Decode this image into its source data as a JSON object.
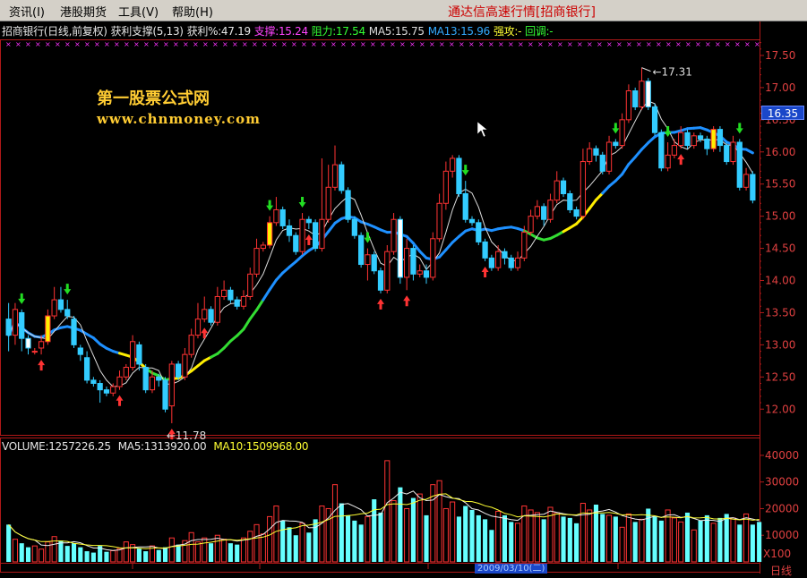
{
  "menu": [
    "资讯(I)",
    "港股期货",
    "工具(V)",
    "帮助(H)"
  ],
  "app_title": "通达信高速行情[招商银行]",
  "info": {
    "title": "招商银行(日线,前复权)",
    "indicator": "获利支撑(5,13)",
    "profit": "获利%:47.19",
    "support": "支撑:15.24",
    "resistance": "阻力:17.54",
    "ma5": "MA5:15.75",
    "ma13": "MA13:15.96",
    "strong": "强攻:-",
    "pullback": "回调:-"
  },
  "watermark": {
    "line1": "第一股票公式网",
    "line2": "www.chnmoney.com"
  },
  "volume_info": {
    "volume": "VOLUME:1257226.25",
    "ma5": "MA5:1313920.00",
    "ma10": "MA10:1509968.00"
  },
  "current_price": "16.35",
  "vol_unit": "X100",
  "date_label": "2009/03/10(二)",
  "period": "日线",
  "colors": {
    "up": "#ff3333",
    "down": "#33ccff",
    "ma_line": "#1e90ff",
    "support_lime": "#33dd33",
    "yellow": "#ffee00",
    "axis": "#b01818"
  },
  "chart_data": {
    "type": "candlestick",
    "price_axis": {
      "ticks": [
        "12.00",
        "12.50",
        "13.00",
        "13.50",
        "14.00",
        "14.50",
        "15.00",
        "15.50",
        "16.00",
        "16.50",
        "17.00",
        "17.50"
      ],
      "range": [
        11.6,
        17.75
      ]
    },
    "annotations": [
      {
        "label": "17.31"
      },
      {
        "label": "11.78"
      }
    ],
    "candles": [
      [
        13.4,
        13.15,
        13.65,
        12.9
      ],
      [
        13.15,
        13.55,
        13.65,
        13.0
      ],
      [
        13.5,
        13.1,
        13.55,
        12.9
      ],
      [
        13.1,
        12.95,
        13.15,
        12.85
      ],
      [
        12.9,
        12.9,
        12.95,
        12.85
      ],
      [
        12.95,
        13.05,
        13.15,
        12.85
      ],
      [
        13.05,
        13.45,
        13.55,
        13.0
      ],
      [
        13.45,
        13.7,
        13.9,
        13.4
      ],
      [
        13.7,
        13.55,
        13.9,
        13.5
      ],
      [
        13.55,
        13.45,
        13.7,
        13.4
      ],
      [
        13.4,
        13.0,
        13.45,
        12.95
      ],
      [
        12.95,
        12.85,
        13.0,
        12.75
      ],
      [
        12.8,
        12.45,
        12.9,
        12.4
      ],
      [
        12.45,
        12.4,
        12.5,
        12.35
      ],
      [
        12.4,
        12.3,
        12.45,
        12.1
      ],
      [
        12.3,
        12.25,
        12.35,
        12.2
      ],
      [
        12.25,
        12.35,
        12.4,
        12.2
      ],
      [
        12.35,
        12.5,
        12.6,
        12.3
      ],
      [
        12.5,
        12.65,
        12.7,
        12.45
      ],
      [
        12.65,
        13.05,
        13.15,
        12.6
      ],
      [
        13.0,
        12.7,
        13.05,
        12.6
      ],
      [
        12.65,
        12.3,
        12.7,
        12.25
      ],
      [
        12.3,
        12.5,
        12.6,
        12.25
      ],
      [
        12.5,
        12.45,
        12.55,
        12.35
      ],
      [
        12.45,
        12.0,
        12.5,
        11.95
      ],
      [
        12.05,
        12.7,
        12.75,
        11.78
      ],
      [
        12.7,
        12.5,
        12.75,
        12.45
      ],
      [
        12.5,
        12.85,
        12.95,
        12.45
      ],
      [
        12.85,
        13.15,
        13.25,
        12.8
      ],
      [
        13.15,
        13.4,
        13.65,
        13.1
      ],
      [
        13.4,
        13.55,
        13.75,
        13.35
      ],
      [
        13.55,
        13.35,
        13.6,
        13.3
      ],
      [
        13.35,
        13.75,
        13.9,
        13.3
      ],
      [
        13.75,
        13.85,
        14.0,
        13.7
      ],
      [
        13.85,
        13.7,
        13.9,
        13.65
      ],
      [
        13.7,
        13.6,
        13.75,
        13.55
      ],
      [
        13.6,
        13.75,
        13.85,
        13.55
      ],
      [
        13.75,
        14.1,
        14.2,
        13.7
      ],
      [
        14.1,
        14.5,
        14.65,
        14.05
      ],
      [
        14.5,
        14.55,
        14.6,
        14.45
      ],
      [
        14.55,
        14.9,
        15.0,
        14.5
      ],
      [
        14.9,
        15.1,
        15.3,
        14.85
      ],
      [
        15.1,
        14.85,
        15.15,
        14.8
      ],
      [
        14.85,
        14.7,
        14.95,
        14.6
      ],
      [
        14.7,
        14.45,
        14.75,
        14.4
      ],
      [
        14.45,
        14.95,
        15.05,
        14.4
      ],
      [
        14.95,
        14.9,
        15.0,
        14.8
      ],
      [
        14.9,
        14.5,
        14.95,
        14.45
      ],
      [
        14.5,
        14.95,
        15.9,
        14.45
      ],
      [
        14.95,
        15.45,
        15.8,
        14.9
      ],
      [
        15.45,
        15.8,
        16.1,
        15.4
      ],
      [
        15.8,
        15.4,
        15.85,
        15.35
      ],
      [
        15.4,
        14.95,
        15.45,
        14.9
      ],
      [
        14.95,
        14.7,
        15.0,
        14.65
      ],
      [
        14.7,
        14.25,
        14.75,
        14.2
      ],
      [
        14.25,
        14.4,
        14.5,
        14.0
      ],
      [
        14.4,
        14.15,
        14.45,
        14.1
      ],
      [
        14.15,
        13.85,
        14.2,
        13.8
      ],
      [
        13.85,
        14.45,
        14.55,
        13.8
      ],
      [
        14.45,
        14.95,
        15.05,
        14.4
      ],
      [
        14.95,
        14.05,
        15.0,
        13.95
      ],
      [
        14.05,
        14.5,
        14.65,
        13.85
      ],
      [
        14.5,
        14.1,
        14.55,
        14.0
      ],
      [
        14.1,
        14.15,
        14.25,
        14.05
      ],
      [
        14.15,
        14.05,
        14.25,
        13.95
      ],
      [
        14.05,
        14.65,
        14.75,
        14.0
      ],
      [
        14.65,
        15.2,
        15.35,
        14.6
      ],
      [
        15.2,
        15.7,
        15.85,
        15.1
      ],
      [
        15.7,
        15.9,
        15.95,
        15.6
      ],
      [
        15.9,
        15.35,
        15.95,
        15.3
      ],
      [
        15.35,
        14.95,
        15.55,
        14.9
      ],
      [
        14.95,
        14.9,
        15.0,
        14.85
      ],
      [
        14.9,
        14.6,
        14.95,
        14.55
      ],
      [
        14.6,
        14.35,
        14.65,
        14.3
      ],
      [
        14.35,
        14.2,
        14.4,
        14.15
      ],
      [
        14.2,
        14.45,
        14.55,
        14.15
      ],
      [
        14.45,
        14.35,
        14.5,
        14.25
      ],
      [
        14.35,
        14.2,
        14.4,
        14.15
      ],
      [
        14.2,
        14.35,
        14.45,
        14.15
      ],
      [
        14.35,
        14.75,
        14.85,
        14.3
      ],
      [
        14.75,
        15.0,
        15.1,
        14.7
      ],
      [
        15.0,
        15.15,
        15.25,
        14.95
      ],
      [
        15.15,
        14.95,
        15.2,
        14.85
      ],
      [
        14.95,
        15.25,
        15.35,
        14.9
      ],
      [
        15.25,
        15.55,
        15.7,
        15.2
      ],
      [
        15.55,
        15.35,
        15.6,
        15.3
      ],
      [
        15.35,
        15.1,
        15.4,
        15.05
      ],
      [
        15.1,
        15.0,
        15.15,
        14.95
      ],
      [
        15.0,
        15.85,
        16.05,
        14.95
      ],
      [
        15.85,
        16.05,
        16.15,
        15.8
      ],
      [
        16.05,
        15.95,
        16.1,
        15.85
      ],
      [
        15.95,
        15.7,
        16.0,
        15.65
      ],
      [
        15.7,
        16.15,
        16.25,
        15.65
      ],
      [
        16.15,
        16.1,
        16.2,
        16.05
      ],
      [
        16.1,
        16.5,
        16.6,
        16.05
      ],
      [
        16.5,
        16.95,
        17.05,
        16.45
      ],
      [
        16.95,
        16.7,
        17.0,
        16.65
      ],
      [
        16.7,
        17.1,
        17.31,
        16.65
      ],
      [
        17.1,
        16.7,
        17.15,
        16.65
      ],
      [
        16.7,
        16.3,
        16.75,
        16.25
      ],
      [
        16.3,
        15.75,
        16.35,
        15.7
      ],
      [
        15.75,
        15.95,
        16.15,
        15.7
      ],
      [
        15.95,
        16.1,
        16.2,
        15.9
      ],
      [
        16.1,
        16.3,
        16.4,
        16.05
      ],
      [
        16.3,
        16.1,
        16.35,
        16.05
      ],
      [
        16.1,
        16.25,
        16.3,
        16.05
      ],
      [
        16.25,
        16.2,
        16.3,
        16.15
      ],
      [
        16.2,
        16.05,
        16.25,
        15.95
      ],
      [
        16.05,
        16.35,
        16.4,
        16.0
      ],
      [
        16.35,
        16.1,
        16.4,
        16.0
      ],
      [
        16.1,
        15.85,
        16.15,
        15.8
      ],
      [
        15.85,
        16.15,
        16.25,
        15.8
      ],
      [
        16.15,
        15.45,
        16.2,
        15.4
      ],
      [
        15.45,
        15.65,
        15.75,
        15.4
      ],
      [
        15.65,
        15.25,
        15.7,
        15.2
      ]
    ],
    "volume_axis": {
      "ticks": [
        "10000",
        "20000",
        "30000",
        "40000"
      ],
      "range": [
        0,
        43000
      ]
    },
    "volumes": [
      14000,
      8500,
      7000,
      5500,
      6000,
      4800,
      7500,
      9500,
      8000,
      6000,
      7000,
      5500,
      4000,
      3500,
      6000,
      3800,
      4200,
      5000,
      7500,
      6500,
      5000,
      4000,
      6000,
      4500,
      5500,
      9000,
      6500,
      8000,
      11000,
      7500,
      9000,
      7000,
      10000,
      8500,
      7000,
      6500,
      9000,
      11500,
      14000,
      10500,
      17000,
      21000,
      15500,
      13000,
      10000,
      14500,
      11000,
      16000,
      21000,
      20000,
      29000,
      22000,
      17500,
      15500,
      14000,
      17000,
      23500,
      18500,
      38000,
      23000,
      28000,
      20000,
      24000,
      25500,
      17500,
      29000,
      30500,
      20000,
      22500,
      17000,
      21000,
      19500,
      17500,
      16000,
      12000,
      19000,
      17500,
      15000,
      14500,
      21000,
      19500,
      18500,
      16000,
      20500,
      18500,
      17000,
      16500,
      14500,
      22000,
      19500,
      21500,
      18000,
      17500,
      17000,
      13000,
      18000,
      15000,
      16000,
      20000,
      17000,
      15500,
      19500,
      16500,
      15000,
      18500,
      12000,
      15500,
      17500,
      14500,
      16500,
      18000,
      16500,
      14000,
      18000,
      14000,
      15000
    ]
  }
}
